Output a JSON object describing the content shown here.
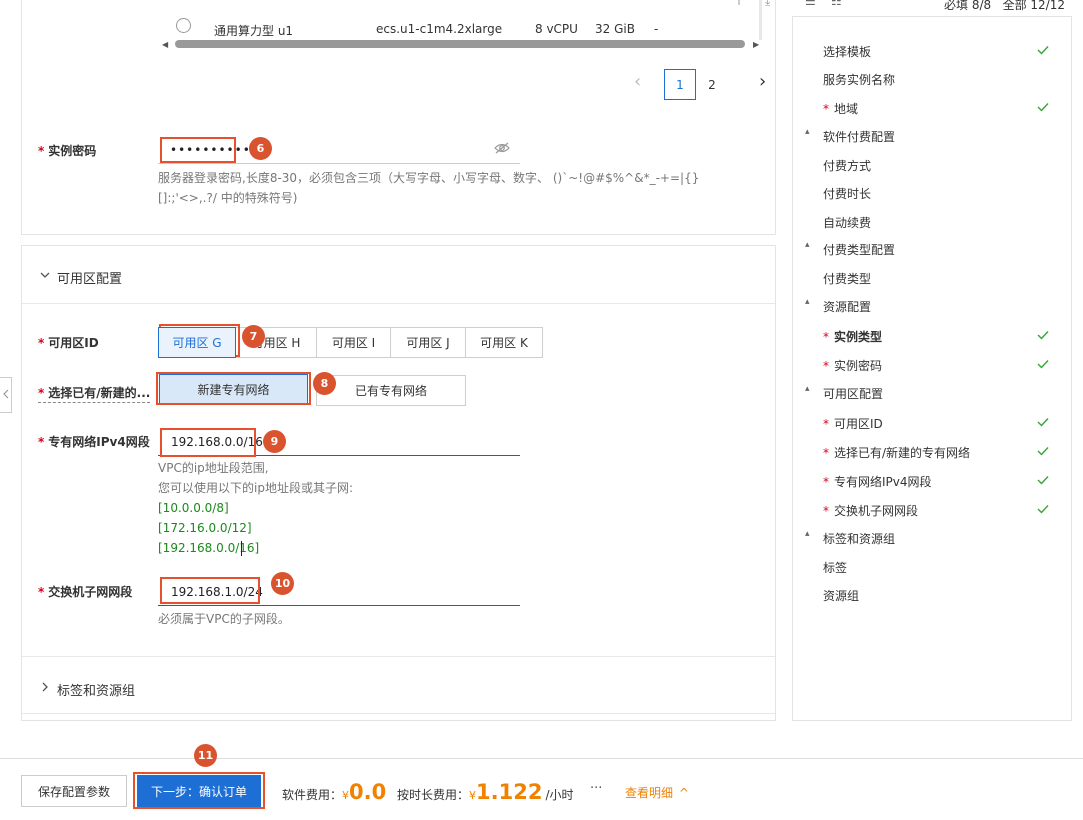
{
  "top_table": {
    "row": {
      "type": "通用算力型 u1",
      "spec": "ecs.u1-c1m4.2xlarge",
      "vcpu": "8 vCPU",
      "mem": "32 GiB",
      "extra": "-"
    },
    "pagination": {
      "prev": "‹",
      "pages": [
        "1",
        "2"
      ],
      "current": "1",
      "next": "›"
    }
  },
  "password": {
    "label": "实例密码",
    "value": "•••••••••••",
    "hint": "服务器登录密码,长度8-30，必须包含三项（大写字母、小写字母、数字、 ()`~!@#$%^&*_-+=|{}[]:;'<>,.?/ 中的特殊符号)"
  },
  "zone_section": {
    "title": "可用区配置",
    "zone_label": "可用区ID",
    "zones": [
      "可用区 G",
      "可用区 H",
      "可用区 I",
      "可用区 J",
      "可用区 K"
    ],
    "selected_zone": "可用区 G",
    "vpc_choice_label": "选择已有/新建的...",
    "vpc_options": [
      "新建专有网络",
      "已有专有网络"
    ],
    "vpc_cidr_label": "专有网络IPv4网段",
    "vpc_cidr_value": "192.168.0.0/16",
    "vpc_hint_1": "VPC的ip地址段范围,",
    "vpc_hint_2": "您可以使用以下的ip地址段或其子网:",
    "vpc_ranges": [
      "[10.0.0.0/8]",
      "[172.16.0.0/12]",
      "[192.168.0.0/16]"
    ],
    "vsw_label": "交换机子网网段",
    "vsw_value": "192.168.1.0/24",
    "vsw_hint": "必须属于VPC的子网段。"
  },
  "tags_section": {
    "title": "标签和资源组"
  },
  "badges": [
    "6",
    "7",
    "8",
    "9",
    "10",
    "11"
  ],
  "right_nav": {
    "header": "必填 8/8   全部 12/12",
    "items": [
      {
        "label": "选择模板",
        "check": true,
        "req": false,
        "group": false,
        "bold": false
      },
      {
        "label": "服务实例名称",
        "check": false,
        "req": false,
        "group": false,
        "bold": false
      },
      {
        "label": "地域",
        "check": true,
        "req": true,
        "group": false,
        "bold": false
      },
      {
        "label": "软件付费配置",
        "check": false,
        "req": false,
        "group": true,
        "bold": false
      },
      {
        "label": "付费方式",
        "check": false,
        "req": false,
        "group": false,
        "bold": false
      },
      {
        "label": "付费时长",
        "check": false,
        "req": false,
        "group": false,
        "bold": false
      },
      {
        "label": "自动续费",
        "check": false,
        "req": false,
        "group": false,
        "bold": false
      },
      {
        "label": "付费类型配置",
        "check": false,
        "req": false,
        "group": true,
        "bold": false
      },
      {
        "label": "付费类型",
        "check": false,
        "req": false,
        "group": false,
        "bold": false
      },
      {
        "label": "资源配置",
        "check": false,
        "req": false,
        "group": true,
        "bold": false
      },
      {
        "label": "实例类型",
        "check": true,
        "req": true,
        "group": false,
        "bold": true
      },
      {
        "label": "实例密码",
        "check": true,
        "req": true,
        "group": false,
        "bold": false
      },
      {
        "label": "可用区配置",
        "check": false,
        "req": false,
        "group": true,
        "bold": false
      },
      {
        "label": "可用区ID",
        "check": true,
        "req": true,
        "group": false,
        "bold": false
      },
      {
        "label": "选择已有/新建的专有网络",
        "check": true,
        "req": true,
        "group": false,
        "bold": false
      },
      {
        "label": "专有网络IPv4网段",
        "check": true,
        "req": true,
        "group": false,
        "bold": false
      },
      {
        "label": "交换机子网网段",
        "check": true,
        "req": true,
        "group": false,
        "bold": false
      },
      {
        "label": "标签和资源组",
        "check": false,
        "req": false,
        "group": true,
        "bold": false
      },
      {
        "label": "标签",
        "check": false,
        "req": false,
        "group": false,
        "bold": false
      },
      {
        "label": "资源组",
        "check": false,
        "req": false,
        "group": false,
        "bold": false
      }
    ]
  },
  "footer": {
    "save": "保存配置参数",
    "next": "下一步：确认订单",
    "software_fee_label": "软件费用：",
    "software_fee_currency": "¥",
    "software_fee_value": "0.0",
    "hourly_fee_label": "按时长费用：",
    "hourly_fee_currency": "¥",
    "hourly_fee_value": "1.122",
    "hourly_unit": "/小时",
    "more": "···",
    "details": "查看明细",
    "details_arrow": "^"
  },
  "colors": {
    "accent": "#1d6fd6",
    "badge": "#d8532e",
    "price": "#f08200",
    "check": "#33a633"
  }
}
